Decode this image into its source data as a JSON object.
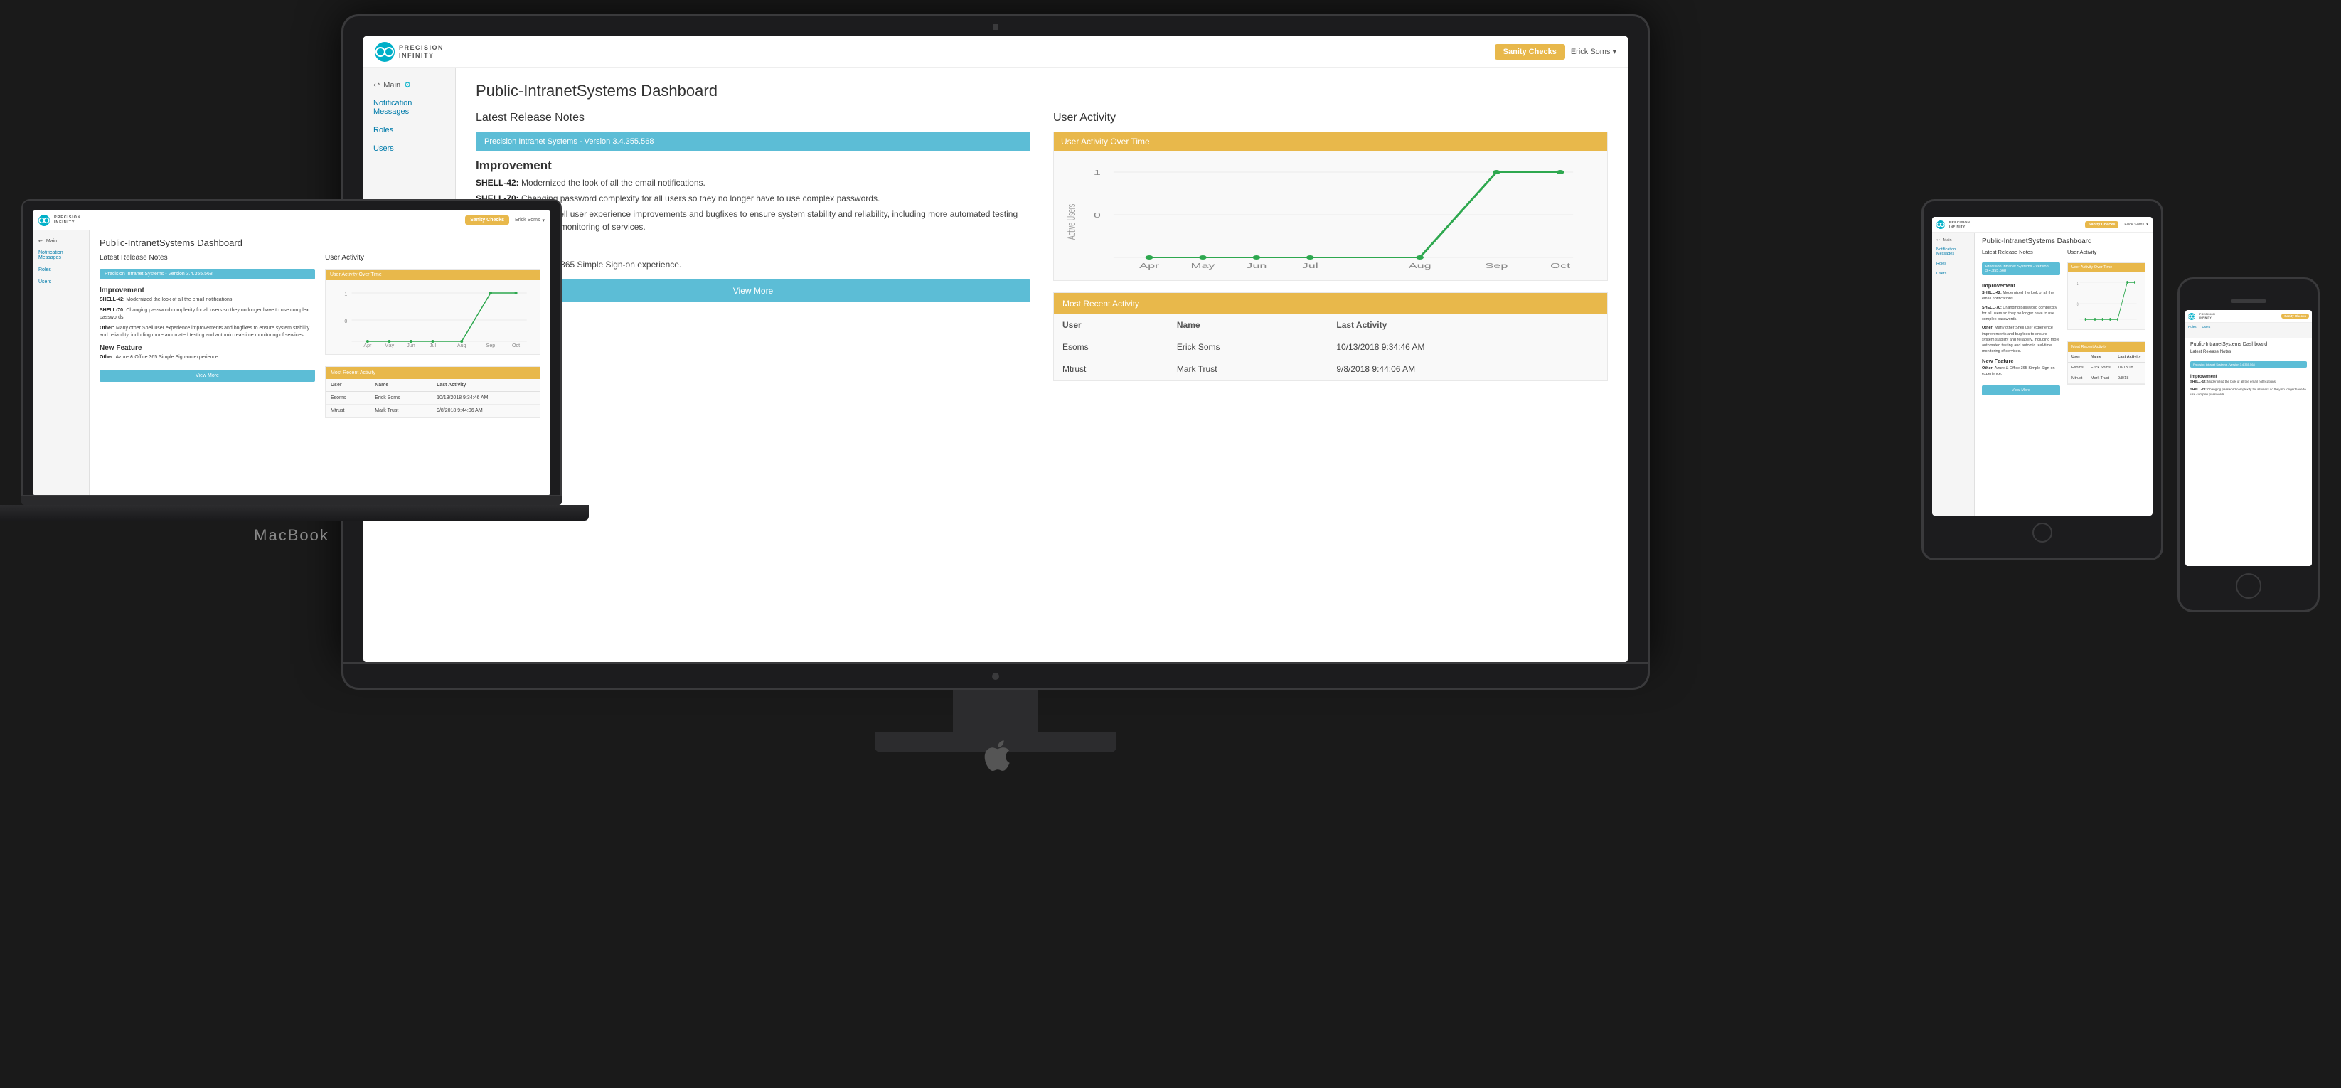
{
  "app": {
    "logo_text_line1": "PRECISION",
    "logo_text_line2": "INFINITY",
    "sanity_checks_label": "Sanity Checks",
    "user_label": "Erick Soms",
    "nav": {
      "main_label": "Main",
      "notification_messages": "Notification Messages",
      "roles": "Roles",
      "users": "Users"
    },
    "page_title": "Public-IntranetSystems Dashboard",
    "latest_release_notes_heading": "Latest Release Notes",
    "user_activity_heading": "User Activity",
    "release_card_title": "Precision Intranet Systems - Version 3.4.355.568",
    "improvement_heading": "Improvement",
    "shell42_label": "SHELL-42:",
    "shell42_text": " Modernized the look of all the email notifications.",
    "shell70_label": "SHELL-70:",
    "shell70_text": " Changing password complexity for all users so they no longer have to use complex passwords.",
    "other_label": "Other:",
    "other_text": " Many other Shell user experience improvements and bugfixes to ensure system stability and reliability, including more automated testing and automic real-time monitoring of services.",
    "new_feature_heading": "New Feature",
    "new_feature_label": "Other:",
    "new_feature_text": " Azure & Office 365 Simple Sign-on experience.",
    "view_more_label": "View More",
    "chart": {
      "title": "User Activity Over Time",
      "y_axis_label": "Active Users",
      "x_labels": [
        "Apr",
        "May",
        "Jun",
        "Jul",
        "Aug",
        "Sep",
        "Oct"
      ],
      "y_min": 0,
      "y_max": 1,
      "data_points": [
        {
          "x": "Apr",
          "y": 0
        },
        {
          "x": "May",
          "y": 0
        },
        {
          "x": "Jun",
          "y": 0
        },
        {
          "x": "Jul",
          "y": 0
        },
        {
          "x": "Aug",
          "y": 0
        },
        {
          "x": "Sep",
          "y": 1
        },
        {
          "x": "Oct",
          "y": 1
        }
      ]
    },
    "most_recent_activity": {
      "title": "Most Recent Activity",
      "columns": [
        "User",
        "Name",
        "Last Activity"
      ],
      "rows": [
        {
          "user": "Esoms",
          "name": "Erick Soms",
          "last_activity": "10/13/2018 9:34:46 AM"
        },
        {
          "user": "Mtrust",
          "name": "Mark Trust",
          "last_activity": "9/8/2018 9:44:06 AM"
        }
      ]
    }
  }
}
